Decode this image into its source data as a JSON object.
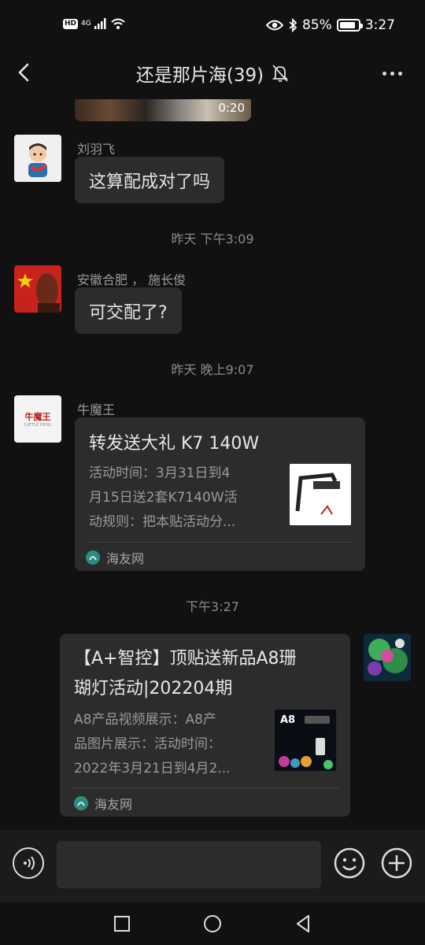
{
  "status_bar": {
    "hd": "HD",
    "network": "4G",
    "battery_percent": "85%",
    "battery_level": 0.85,
    "time": "3:27"
  },
  "header": {
    "title": "还是那片海(39)",
    "icons": [
      "back-arrow-icon",
      "mute-bell-icon",
      "more-icon"
    ]
  },
  "messages": {
    "video": {
      "duration": "0:20"
    },
    "m1": {
      "sender": "刘羽飞",
      "text": "这算配成对了吗"
    },
    "ts1": "昨天 下午3:09",
    "m2": {
      "sender": "安徽合肥 ， 施长俊",
      "text": "可交配了?"
    },
    "ts2": "昨天 晚上9:07",
    "m3": {
      "sender": "牛魔王",
      "avatar_text": "牛魔王",
      "avatar_sub": "CATTLE DEVIL",
      "title": "转发送大礼 K7 140W",
      "desc": [
        "活动时间：3月31日到4",
        "月15日送2套K7140W活",
        "动规则：把本贴活动分..."
      ],
      "source": "海友网"
    },
    "ts3": "下午3:27",
    "m4": {
      "title": [
        "【A+智控】顶贴送新品A8珊",
        "瑚灯活动|202204期"
      ],
      "desc": [
        "A8产品视频展示：A8产",
        "品图片展示：活动时间：",
        "2022年3月21日到4月2..."
      ],
      "source": "海友网",
      "thumb_label": "A8"
    }
  },
  "input_bar": {
    "placeholder": ""
  },
  "colors": {
    "bg": "#111111",
    "bubble": "#2c2c2c",
    "accent": "#2b8c82"
  }
}
